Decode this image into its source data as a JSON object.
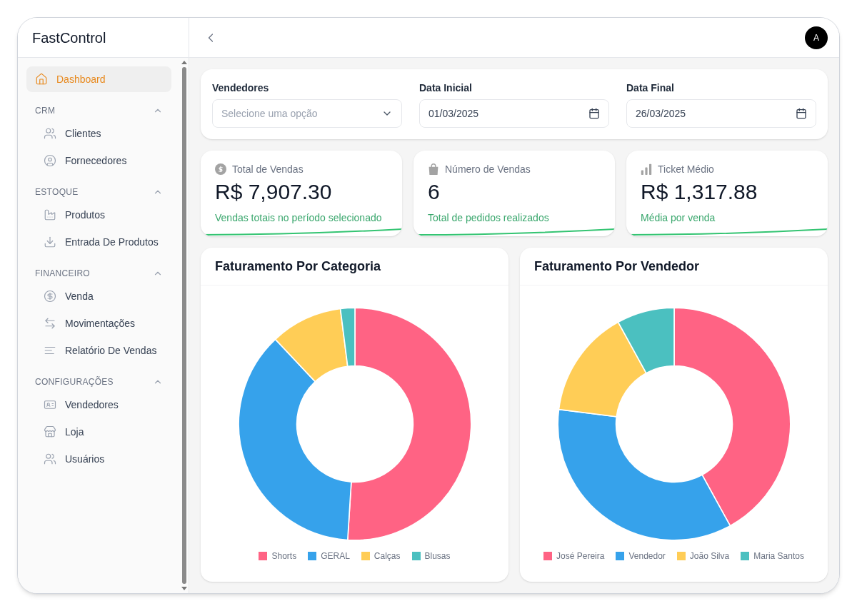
{
  "sidebar": {
    "app_name": "FastControl",
    "items": [
      {
        "label": "Dashboard",
        "selected": true
      }
    ],
    "sections": [
      {
        "title": "CRM",
        "expanded": true,
        "items": [
          {
            "label": "Clientes",
            "selected": false
          },
          {
            "label": "Fornecedores",
            "selected": false
          }
        ]
      },
      {
        "title": "ESTOQUE",
        "expanded": true,
        "items": [
          {
            "label": "Produtos",
            "selected": false
          },
          {
            "label": "Entrada De Produtos",
            "selected": false
          }
        ]
      },
      {
        "title": "FINANCEIRO",
        "expanded": true,
        "items": [
          {
            "label": "Venda",
            "selected": false
          },
          {
            "label": "Movimentações",
            "selected": false
          },
          {
            "label": "Relatório De Vendas",
            "selected": false
          }
        ]
      },
      {
        "title": "CONFIGURAÇÕES",
        "expanded": true,
        "items": [
          {
            "label": "Vendedores",
            "selected": false
          },
          {
            "label": "Loja",
            "selected": false
          },
          {
            "label": "Usuários",
            "selected": false
          }
        ]
      }
    ]
  },
  "top_bar": {
    "avatar": "A"
  },
  "filters": {
    "seller": {
      "label": "Vendedores",
      "placeholder": "Selecione uma opção"
    },
    "start_date": {
      "label": "Data Inicial",
      "value": "01/03/2025"
    },
    "end_date": {
      "label": "Data Final",
      "value": "26/03/2025"
    }
  },
  "stats": [
    {
      "title": "Total de Vendas",
      "value": "R$ 7,907.30",
      "caption": "Vendas totais no período selecionado"
    },
    {
      "title": "Número de Vendas",
      "value": "6",
      "caption": "Total de pedidos realizados"
    },
    {
      "title": "Ticket Médio",
      "value": "R$ 1,317.88",
      "caption": "Média por venda"
    }
  ],
  "charts": [
    {
      "chart_data": {
        "type": "donut",
        "title": "Faturamento Por Categoria",
        "categories": [
          "Shorts",
          "GERAL",
          "Calças",
          "Blusas"
        ],
        "values": [
          51,
          37,
          10,
          2
        ],
        "colors": [
          "#ff6384",
          "#36a2eb",
          "#ffcd56",
          "#4bc0c0"
        ]
      }
    },
    {
      "chart_data": {
        "type": "donut",
        "title": "Faturamento Por Vendedor",
        "categories": [
          "José Pereira",
          "Vendedor",
          "João Silva",
          "Maria Santos"
        ],
        "values": [
          42,
          35,
          15,
          8
        ],
        "colors": [
          "#ff6384",
          "#36a2eb",
          "#ffcd56",
          "#4bc0c0"
        ]
      }
    }
  ]
}
